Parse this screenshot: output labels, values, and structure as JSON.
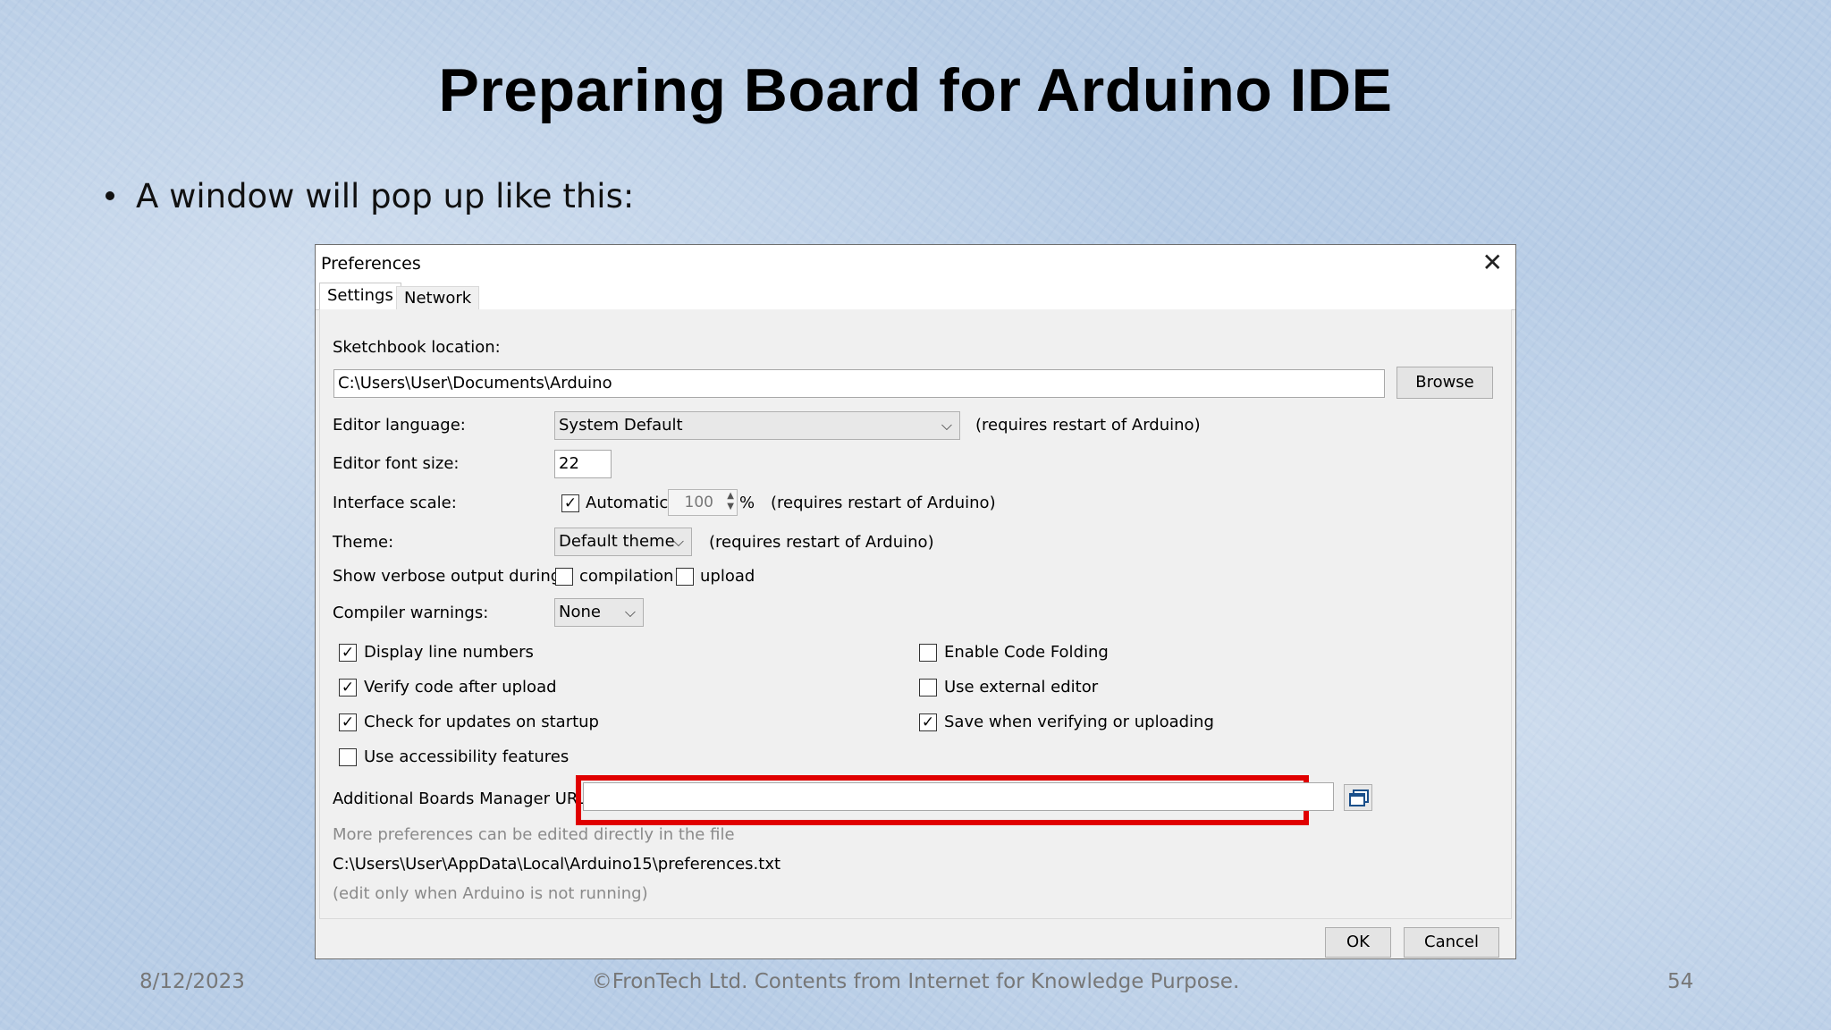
{
  "slide": {
    "title": "Preparing Board for Arduino IDE",
    "bullet": "A window will pop up like this:",
    "footer_date": "8/12/2023",
    "footer_center": "©FronTech Ltd. Contents from Internet for Knowledge Purpose.",
    "page_number": "54"
  },
  "dialog": {
    "title": "Preferences",
    "close_icon": "close-icon",
    "tabs": [
      {
        "label": "Settings",
        "active": true
      },
      {
        "label": "Network",
        "active": false
      }
    ],
    "sketchbook_label": "Sketchbook location:",
    "sketchbook_value": "C:\\Users\\User\\Documents\\Arduino",
    "browse_label": "Browse",
    "editor_language_label": "Editor language:",
    "editor_language_value": "System Default",
    "restart_note": "(requires restart of Arduino)",
    "font_size_label": "Editor font size:",
    "font_size_value": "22",
    "interface_scale_label": "Interface scale:",
    "automatic_label": "Automatic",
    "automatic_checked": true,
    "scale_value": "100",
    "percent": "%",
    "theme_label": "Theme:",
    "theme_value": "Default theme",
    "verbose_label": "Show verbose output during:",
    "compilation_label": "compilation",
    "upload_label": "upload",
    "compiler_warnings_label": "Compiler warnings:",
    "compiler_warnings_value": "None",
    "options_left": [
      {
        "label": "Display line numbers",
        "checked": true
      },
      {
        "label": "Verify code after upload",
        "checked": true
      },
      {
        "label": "Check for updates on startup",
        "checked": true
      },
      {
        "label": "Use accessibility features",
        "checked": false
      }
    ],
    "options_right": [
      {
        "label": "Enable Code Folding",
        "checked": false
      },
      {
        "label": "Use external editor",
        "checked": false
      },
      {
        "label": "Save when verifying or uploading",
        "checked": true
      }
    ],
    "boards_urls_label": "Additional Boards Manager URLs:",
    "boards_urls_value": "",
    "more_prefs_note": "More preferences can be edited directly in the file",
    "prefs_path": "C:\\Users\\User\\AppData\\Local\\Arduino15\\preferences.txt",
    "edit_note": "(edit only when Arduino is not running)",
    "ok_label": "OK",
    "cancel_label": "Cancel",
    "highlight_color": "#e00000"
  }
}
